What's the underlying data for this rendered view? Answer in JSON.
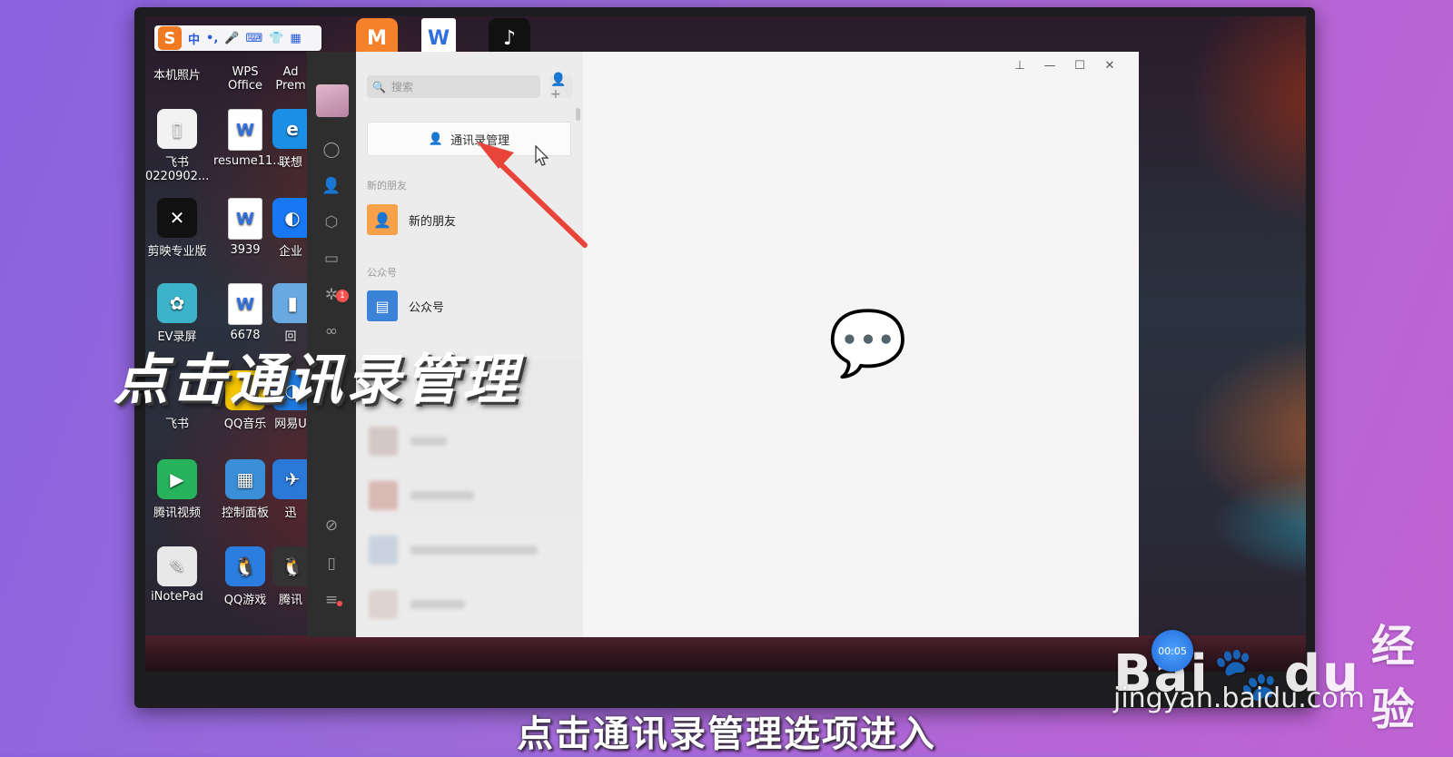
{
  "desktop": {
    "ime": {
      "logo": "S",
      "items": [
        "中",
        "•,",
        "🎤",
        "⌨",
        "👕",
        "▦"
      ]
    },
    "top_apps": [
      {
        "name": "mango-tv",
        "glyph": "M",
        "color": "#f5822a"
      },
      {
        "name": "wps-doc",
        "glyph": "W",
        "color": "#ffffff"
      },
      {
        "name": "tiktok",
        "glyph": "♪",
        "color": "#111111"
      }
    ],
    "icons": [
      {
        "label": "本机照片",
        "glyph": "",
        "color": "transparent"
      },
      {
        "label": "WPS Office",
        "glyph": "",
        "color": "transparent"
      },
      {
        "label": "Ad Prem",
        "glyph": "",
        "color": "transparent"
      },
      {
        "label": "飞书 0220902...",
        "glyph": "▯",
        "color": "#f2f2f2"
      },
      {
        "label": "resume11...",
        "glyph": "W",
        "color": "#ffffff"
      },
      {
        "label": "联想",
        "glyph": "e",
        "color": "#1b8fe6"
      },
      {
        "label": "剪映专业版",
        "glyph": "✕",
        "color": "#111111"
      },
      {
        "label": "3939",
        "glyph": "W",
        "color": "#ffffff"
      },
      {
        "label": "企业",
        "glyph": "◐",
        "color": "#1877f2"
      },
      {
        "label": "EV录屏",
        "glyph": "✿",
        "color": "#3db3c9"
      },
      {
        "label": "6678",
        "glyph": "W",
        "color": "#ffffff"
      },
      {
        "label": "回",
        "glyph": "▮",
        "color": "#6aa9e0"
      },
      {
        "label": "飞书",
        "glyph": "",
        "color": "transparent"
      },
      {
        "label": "QQ音乐",
        "glyph": "♫",
        "color": "#f4c400"
      },
      {
        "label": "网易U",
        "glyph": "◑",
        "color": "#1f7ae0"
      },
      {
        "label": "腾讯视频",
        "glyph": "▶",
        "color": "#27b35c"
      },
      {
        "label": "控制面板",
        "glyph": "▦",
        "color": "#3b8fd8"
      },
      {
        "label": "迅",
        "glyph": "✈",
        "color": "#2a78d8"
      },
      {
        "label": "iNotePad",
        "glyph": "✎",
        "color": "#e8e8e8"
      },
      {
        "label": "QQ游戏",
        "glyph": "🐧",
        "color": "#2b7de0"
      },
      {
        "label": "腾讯",
        "glyph": "🐧",
        "color": "#333333"
      }
    ]
  },
  "wechat": {
    "search": {
      "placeholder": "搜索"
    },
    "contact_manage_label": "通讯录管理",
    "sections": {
      "new_friends_header": "新的朋友",
      "new_friends_item": "新的朋友",
      "official_header": "公众号",
      "official_item": "公众号"
    },
    "sidebar_badge": "1",
    "colors": {
      "accent": "#07c160",
      "arrow": "#e8443a"
    }
  },
  "overlay_title": "点击通讯录管理",
  "caption": "点击通讯录管理选项进入",
  "watermark": {
    "brand": "Bai",
    "brand_tail": "du",
    "brand_cn": "经验",
    "url": "jingyan.baidu.com",
    "timer": "00:05"
  }
}
